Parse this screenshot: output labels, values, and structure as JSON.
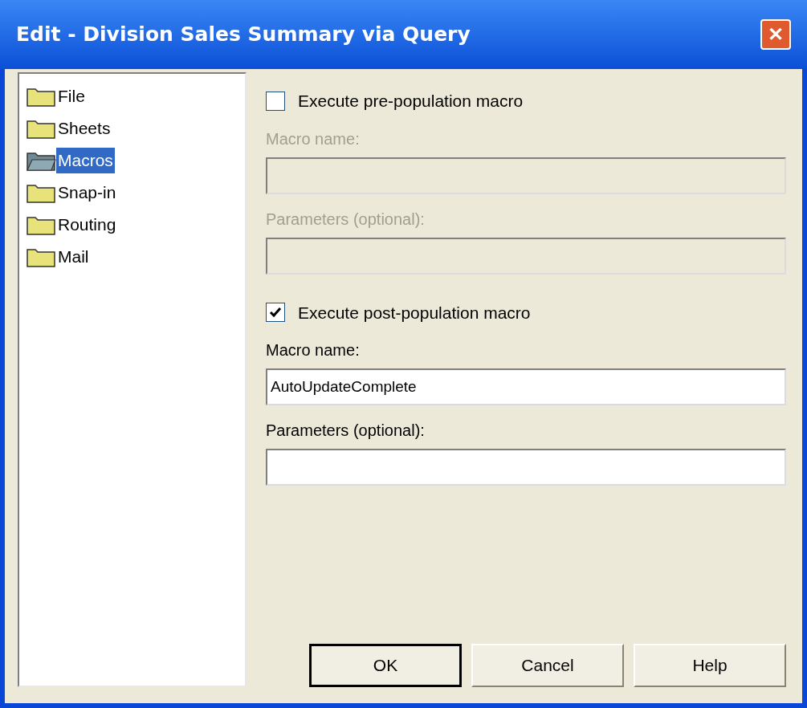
{
  "window": {
    "title": "Edit - Division Sales Summary via Query",
    "close_label": "✕"
  },
  "tree": [
    {
      "label": "File",
      "selected": false
    },
    {
      "label": "Sheets",
      "selected": false
    },
    {
      "label": "Macros",
      "selected": true
    },
    {
      "label": "Snap-in",
      "selected": false
    },
    {
      "label": "Routing",
      "selected": false
    },
    {
      "label": "Mail",
      "selected": false
    }
  ],
  "sections": [
    {
      "label": "Execute pre-population macro",
      "checked": false,
      "fields": [
        {
          "label": "Macro name:"
        },
        {
          "label": "Parameters (optional):"
        }
      ]
    },
    {
      "label": "Execute post-population macro",
      "checked": true,
      "fields": [
        {
          "label": "Macro name:",
          "value": "AutoUpdateComplete"
        },
        {
          "label": "Parameters (optional):"
        }
      ]
    }
  ],
  "buttons": [
    {
      "label": "OK",
      "default": true
    },
    {
      "label": "Cancel",
      "default": false
    },
    {
      "label": "Help",
      "default": false
    }
  ]
}
